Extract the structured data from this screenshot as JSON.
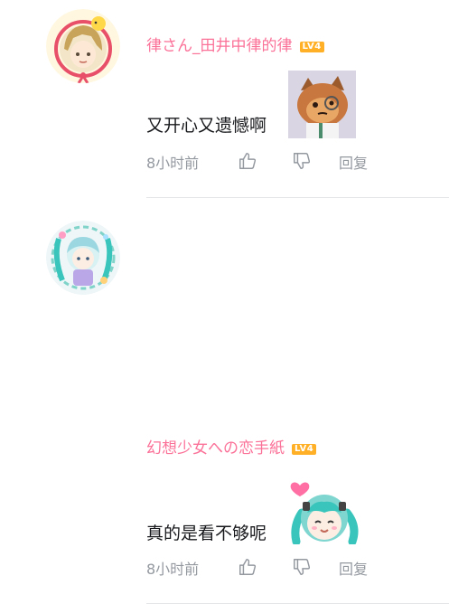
{
  "comments": [
    {
      "username": "律さん_田井中律的律",
      "level": "LV4",
      "text": "又开心又遗憾啊",
      "time": "8小时前",
      "reply_label": "回复"
    },
    {
      "username": "幻想少女への恋手紙",
      "level": "LV4",
      "text": "真的是看不够呢",
      "time": "8小时前",
      "reply_label": "回复"
    }
  ],
  "colors": {
    "username": "#fb7299",
    "level_badge": "#ffb027",
    "meta_text": "#9499a0",
    "divider": "#e3e5e7"
  },
  "icons": {
    "like": "thumb-up-icon",
    "dislike": "thumb-down-icon"
  }
}
